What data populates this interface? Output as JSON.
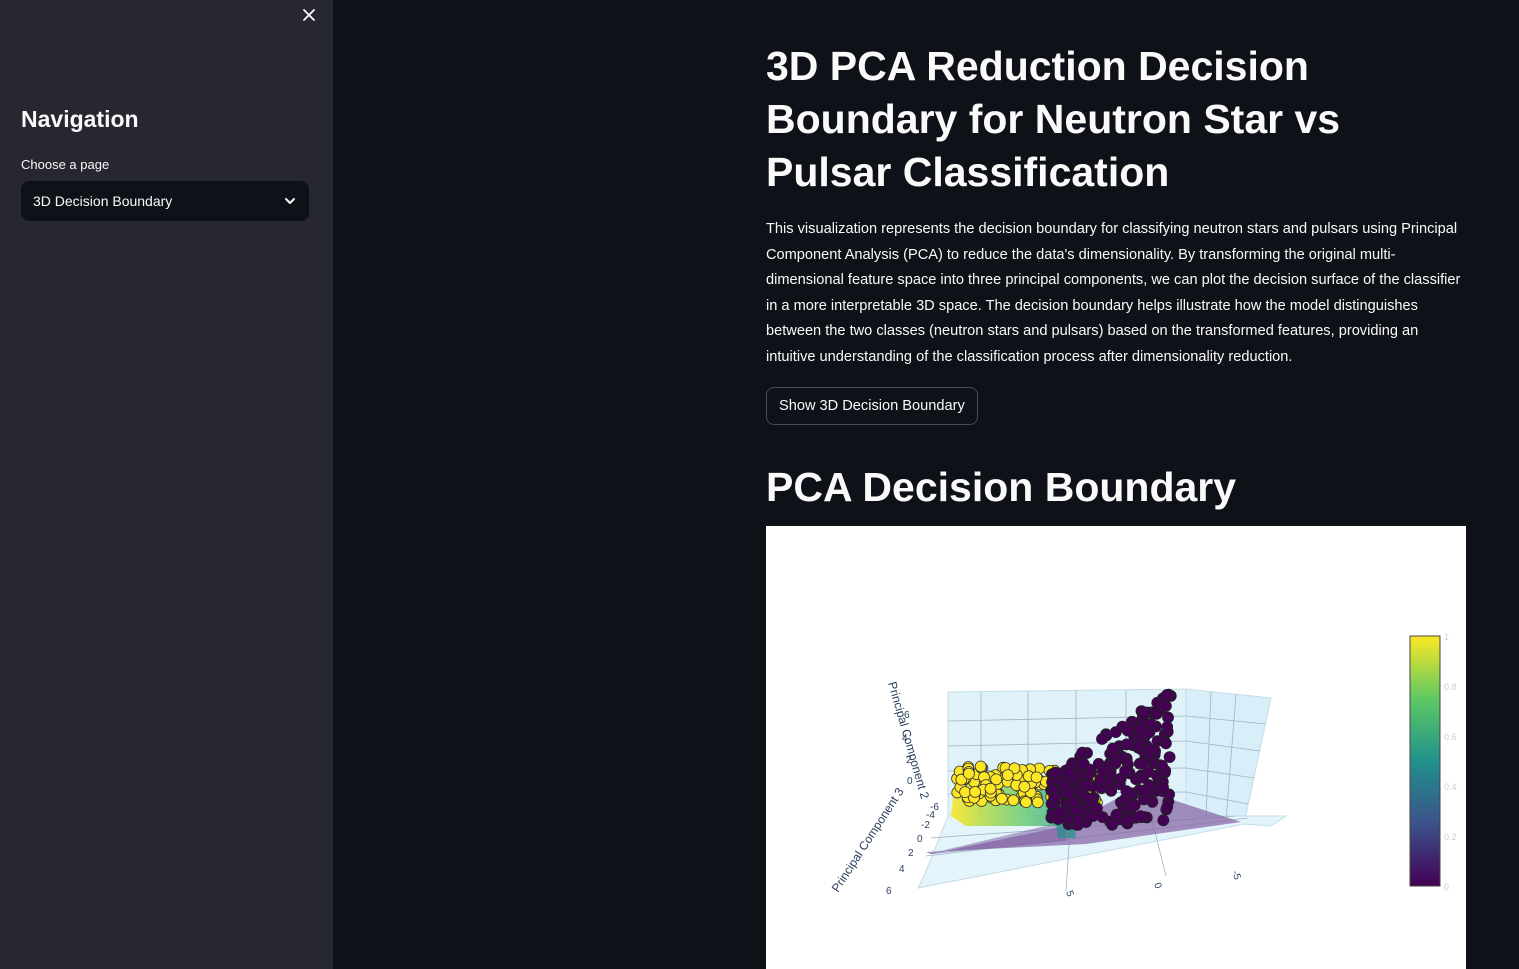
{
  "sidebar": {
    "title": "Navigation",
    "select_label": "Choose a page",
    "select_value": "3D Decision Boundary"
  },
  "main": {
    "title": "3D PCA Reduction Decision Boundary for Neutron Star vs Pulsar Classification",
    "description": "This visualization represents the decision boundary for classifying neutron stars and pulsars using Principal Component Analysis (PCA) to reduce the data's dimensionality. By transforming the original multi-dimensional feature space into three principal components, we can plot the decision surface of the classifier in a more interpretable 3D space. The decision boundary helps illustrate how the model distinguishes between the two classes (neutron stars and pulsars) based on the transformed features, providing an intuitive understanding of the classification process after dimensionality reduction.",
    "button_label": "Show 3D Decision Boundary",
    "section_title": "PCA Decision Boundary"
  },
  "colors": {
    "background": "#0e1117",
    "sidebar": "#262730",
    "class_0": "#440154",
    "class_1": "#fde725"
  },
  "chart_data": {
    "type": "scatter",
    "axis_labels": [
      "Principal Component 2",
      "Principal Component 3"
    ],
    "vertical_ticks": [
      "6",
      "4",
      "2",
      "0"
    ],
    "depth_ticks": [
      "-6",
      "-4",
      "-2",
      "0",
      "2",
      "4",
      "6"
    ],
    "front_ticks": [
      "5",
      "0",
      "-5"
    ],
    "colorbar": {
      "colorscale": "viridis",
      "range": [
        0,
        1
      ],
      "ticks": [
        "1",
        "0.8",
        "0.6",
        "0.4",
        "0.2",
        "0"
      ]
    },
    "classes": [
      {
        "value": 1,
        "color": "#fde725"
      },
      {
        "value": 0,
        "color": "#440154"
      }
    ]
  }
}
